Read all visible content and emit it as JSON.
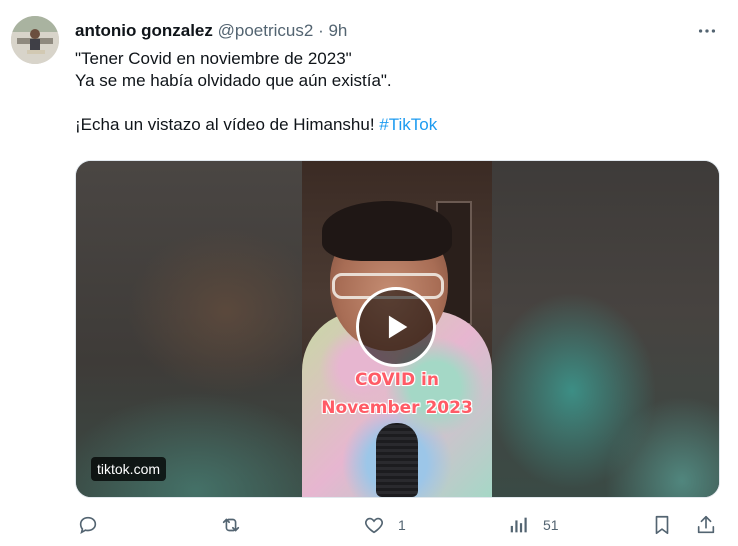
{
  "tweet": {
    "author_name": "antonio gonzalez",
    "handle": "@poetricus2",
    "separator": "·",
    "time": "9h",
    "text_line1": "\"Tener Covid en noviembre de 2023\"",
    "text_line2": "Ya se me había olvidado que aún existía\".",
    "text_line3": "¡Echa un vistazo al vídeo de Himanshu!",
    "hashtag": "#TikTok"
  },
  "media": {
    "caption_line1": "COVID in",
    "caption_line2": "November 2023",
    "domain": "tiktok.com"
  },
  "actions": {
    "reply_count": "",
    "retweet_count": "",
    "like_count": "1",
    "views_count": "51"
  },
  "colors": {
    "accent": "#1d9bf0",
    "secondary_text": "#536471",
    "caption": "#ff5b66"
  },
  "icons": [
    "more-icon",
    "reply-icon",
    "retweet-icon",
    "like-icon",
    "views-icon",
    "bookmark-icon",
    "share-icon",
    "play-icon"
  ]
}
